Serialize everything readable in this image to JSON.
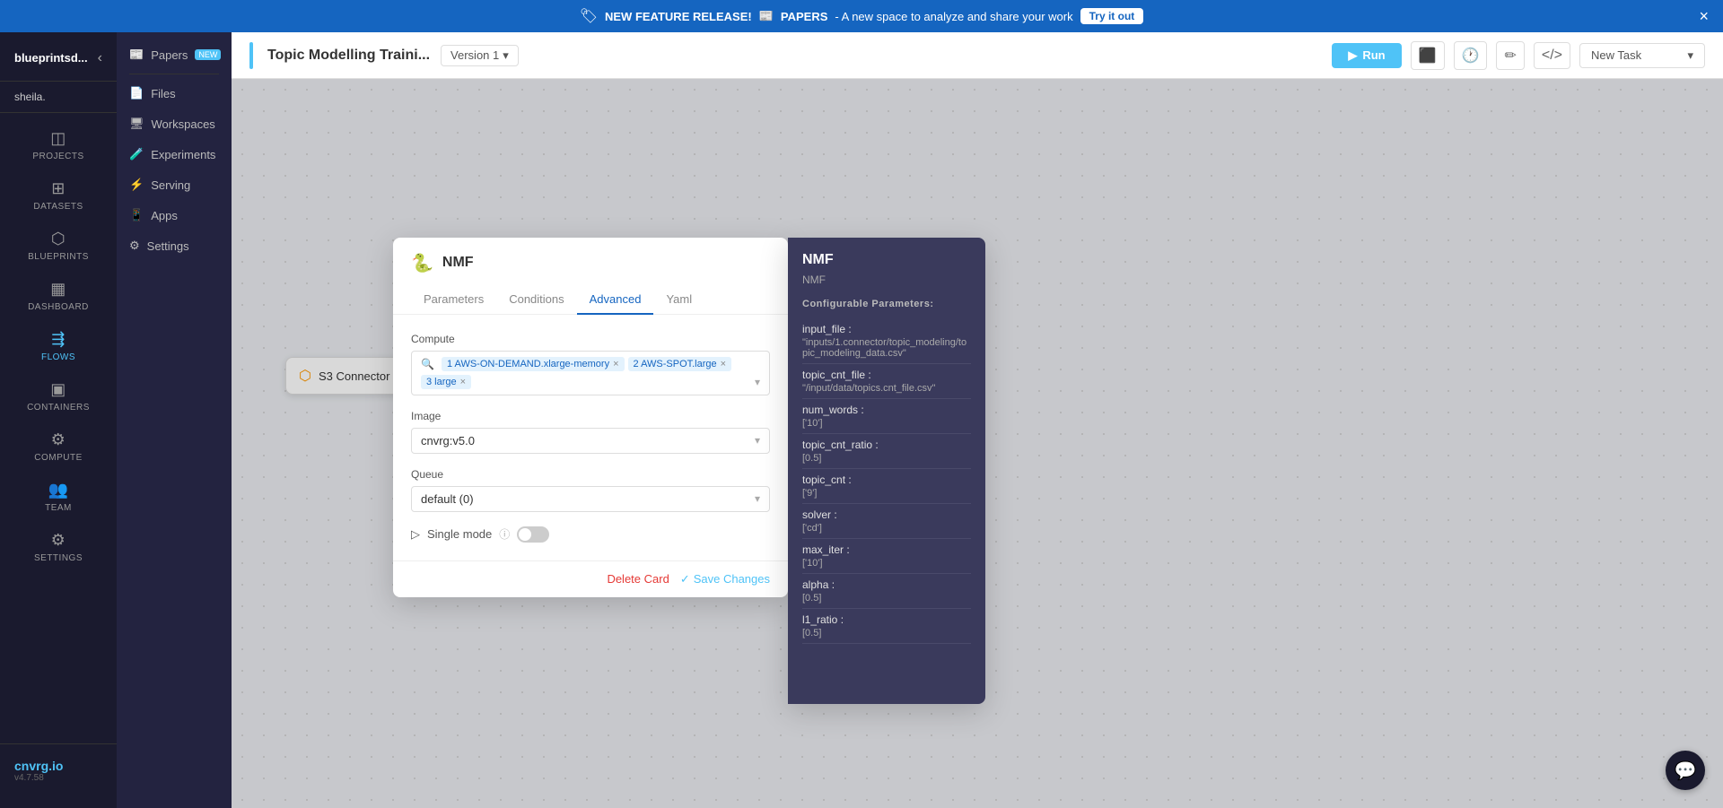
{
  "banner": {
    "text": "NEW FEATURE RELEASE!",
    "papers_label": "PAPERS",
    "description": " - A new space to analyze and share your work",
    "cta": "Try it out"
  },
  "sidebar1": {
    "app_name": "blueprintsd...",
    "user": "sheila.",
    "items": [
      {
        "label": "PROJECTS",
        "icon": "◫"
      },
      {
        "label": "DATASETS",
        "icon": "⊞"
      },
      {
        "label": "BLUEPRINTS",
        "icon": "⬡"
      },
      {
        "label": "DASHBOARD",
        "icon": "▦"
      },
      {
        "label": "Flows",
        "icon": "⇶",
        "active": true
      },
      {
        "label": "CONTAINERS",
        "icon": "▣"
      },
      {
        "label": "COMPUTE",
        "icon": "⚙"
      },
      {
        "label": "TEAM",
        "icon": "👥"
      },
      {
        "label": "SETTINGS",
        "icon": "⚙"
      }
    ],
    "logo": "cnvrg.io",
    "version": "v4.7.58"
  },
  "sidebar2": {
    "items": [
      {
        "label": "Papers",
        "badge": "NEW"
      },
      {
        "label": "Files",
        "icon": "📄"
      },
      {
        "label": "Workspaces",
        "icon": "🖥"
      },
      {
        "label": "Experiments",
        "icon": "🧪"
      },
      {
        "label": "Serving",
        "icon": "⚡"
      },
      {
        "label": "Apps",
        "icon": "📱"
      },
      {
        "label": "Settings",
        "icon": "⚙"
      }
    ]
  },
  "topbar": {
    "title": "Topic Modelling Traini...",
    "version": "Version 1",
    "run_label": "Run",
    "new_task_placeholder": "New Task"
  },
  "canvas": {
    "s3_node_label": "S3 Connector"
  },
  "modal": {
    "icon": "🐍",
    "title": "NMF",
    "tabs": [
      "Parameters",
      "Conditions",
      "Advanced",
      "Yaml"
    ],
    "active_tab": "Advanced",
    "compute_label": "Compute",
    "compute_tags": [
      "1 AWS-ON-DEMAND.xlarge-memory",
      "2 AWS-SPOT.large",
      "3 large"
    ],
    "image_label": "Image",
    "image_value": "cnvrg:v5.0",
    "queue_label": "Queue",
    "queue_value": "default (0)",
    "single_mode_label": "Single mode",
    "delete_label": "Delete Card",
    "save_label": "Save Changes"
  },
  "right_panel": {
    "title": "NMF",
    "subtitle": "NMF",
    "section_label": "Configurable Parameters:",
    "params": [
      {
        "name": "input_file",
        "value": "\"inputs/1.connector/topic_modeling/topic_modeling_data.csv\""
      },
      {
        "name": "topic_cnt_file",
        "value": "\"/input/data/topics.cnt_file.csv\""
      },
      {
        "name": "num_words",
        "value": "['10']"
      },
      {
        "name": "topic_cnt_ratio",
        "value": "[0.5]"
      },
      {
        "name": "topic_cnt",
        "value": "['9']"
      },
      {
        "name": "solver",
        "value": "['cd']"
      },
      {
        "name": "max_iter",
        "value": "['10']"
      },
      {
        "name": "alpha",
        "value": "[0.5]"
      },
      {
        "name": "l1_ratio",
        "value": "[0.5]"
      }
    ]
  }
}
